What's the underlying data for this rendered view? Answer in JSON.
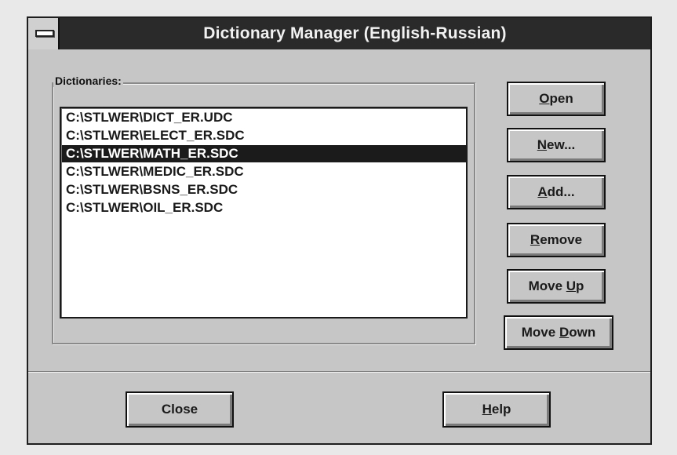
{
  "window": {
    "title": "Dictionary Manager (English-Russian)"
  },
  "dictionaries": {
    "label": "Dictionaries:",
    "items": [
      "C:\\STLWER\\DICT_ER.UDC",
      "C:\\STLWER\\ELECT_ER.SDC",
      "C:\\STLWER\\MATH_ER.SDC",
      "C:\\STLWER\\MEDIC_ER.SDC",
      "C:\\STLWER\\BSNS_ER.SDC",
      "C:\\STLWER\\OIL_ER.SDC"
    ],
    "selected_item": "C:\\STLWER\\MATH_ER.SDC"
  },
  "buttons": {
    "open": {
      "before": "",
      "key": "O",
      "after": "pen"
    },
    "new": {
      "before": "",
      "key": "N",
      "after": "ew..."
    },
    "add": {
      "before": "",
      "key": "A",
      "after": "dd..."
    },
    "remove": {
      "before": "",
      "key": "R",
      "after": "emove"
    },
    "move_up": {
      "before": "Move ",
      "key": "U",
      "after": "p"
    },
    "move_down": {
      "before": "Move ",
      "key": "D",
      "after": "own"
    },
    "close": {
      "label": "Close"
    },
    "help": {
      "before": "",
      "key": "H",
      "after": "elp"
    }
  }
}
